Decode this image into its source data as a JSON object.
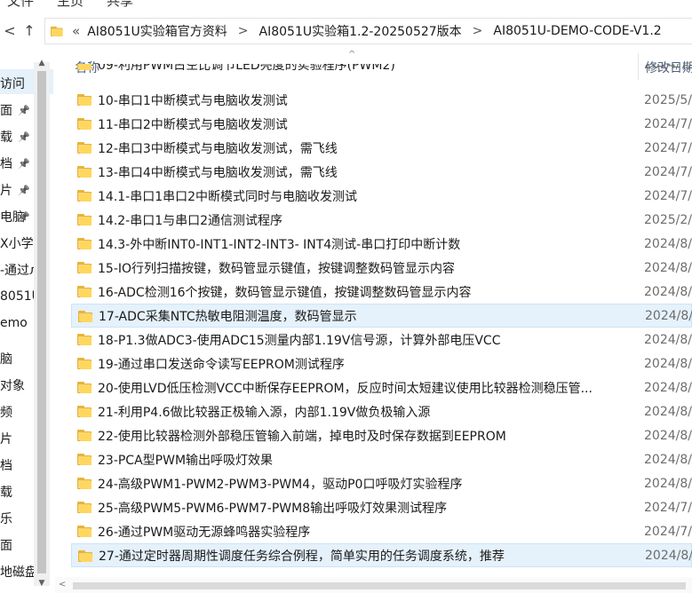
{
  "menu": {
    "items": [
      "文件",
      "主页",
      "共享",
      "查看"
    ]
  },
  "nav": {
    "back_glyph": "<",
    "up_glyph": "↑",
    "address_lead": "«",
    "breadcrumbs": [
      "AI8051U实验箱官方资料",
      "AI8051U实验箱1.2-20250527版本",
      "AI8051U-DEMO-CODE-V1.2"
    ],
    "crumb_sep": ">"
  },
  "navpane": {
    "items": [
      {
        "label": "访问",
        "pinned": false
      },
      {
        "label": "面",
        "pinned": true
      },
      {
        "label": "载",
        "pinned": true
      },
      {
        "label": "档",
        "pinned": true
      },
      {
        "label": "片",
        "pinned": true
      },
      {
        "label": "电脑",
        "pinned": true
      },
      {
        "label": "X小学",
        "pinned": false
      },
      {
        "label": "-通过л",
        "pinned": false
      },
      {
        "label": "8051U",
        "pinned": false
      },
      {
        "label": "emo",
        "pinned": false
      },
      {
        "label": "脑",
        "pinned": false
      },
      {
        "label": "对象",
        "pinned": false
      },
      {
        "label": "频",
        "pinned": false
      },
      {
        "label": "片",
        "pinned": false
      },
      {
        "label": "档",
        "pinned": false
      },
      {
        "label": "载",
        "pinned": false
      },
      {
        "label": "乐",
        "pinned": false
      },
      {
        "label": "面",
        "pinned": false
      },
      {
        "label": "地磁盘",
        "pinned": false
      }
    ]
  },
  "list": {
    "header": {
      "name": "名称",
      "date": "修改日期"
    },
    "rows": [
      {
        "name": "09-利用PWM占空比调节LED亮度的实验程序(PWM2)",
        "date": "2024/7/",
        "selected": false,
        "partial": true
      },
      {
        "name": "10-串口1中断模式与电脑收发测试",
        "date": "2025/5/",
        "selected": false
      },
      {
        "name": "11-串口2中断模式与电脑收发测试",
        "date": "2024/7/",
        "selected": false
      },
      {
        "name": "12-串口3中断模式与电脑收发测试，需飞线",
        "date": "2024/7/",
        "selected": false
      },
      {
        "name": "13-串口4中断模式与电脑收发测试，需飞线",
        "date": "2024/7/",
        "selected": false
      },
      {
        "name": "14.1-串口1串口2中断模式同时与电脑收发测试",
        "date": "2024/7/",
        "selected": false
      },
      {
        "name": "14.2-串口1与串口2通信测试程序",
        "date": "2025/2/",
        "selected": false
      },
      {
        "name": "14.3-外中断INT0-INT1-INT2-INT3- INT4测试-串口打印中断计数",
        "date": "2024/8/",
        "selected": false
      },
      {
        "name": "15-IO行列扫描按键，数码管显示键值，按键调整数码管显示内容",
        "date": "2024/8/",
        "selected": false
      },
      {
        "name": "16-ADC检测16个按键，数码管显示键值，按键调整数码管显示内容",
        "date": "2024/8/",
        "selected": false
      },
      {
        "name": "17-ADC采集NTC热敏电阻测温度，数码管显示",
        "date": "2024/8/",
        "selected": true
      },
      {
        "name": "18-P1.3做ADC3-使用ADC15测量内部1.19V信号源，计算外部电压VCC",
        "date": "2024/8/",
        "selected": false
      },
      {
        "name": "19-通过串口发送命令读写EEPROM测试程序",
        "date": "2024/8/",
        "selected": false
      },
      {
        "name": "20-使用LVD低压检测VCC中断保存EEPROM，反应时间太短建议使用比较器检测稳压管...",
        "date": "2024/8/",
        "selected": false
      },
      {
        "name": "21-利用P4.6做比较器正极输入源，内部1.19V做负极输入源",
        "date": "2024/8/",
        "selected": false
      },
      {
        "name": "22-使用比较器检测外部稳压管输入前端，掉电时及时保存数据到EEPROM",
        "date": "2024/8/",
        "selected": false
      },
      {
        "name": "23-PCA型PWM输出呼吸灯效果",
        "date": "2024/8/",
        "selected": false
      },
      {
        "name": "24-高级PWM1-PWM2-PWM3-PWM4，驱动P0口呼吸灯实验程序",
        "date": "2024/8/",
        "selected": false
      },
      {
        "name": "25-高级PWM5-PWM6-PWM7-PWM8输出呼吸灯效果测试程序",
        "date": "2024/7/",
        "selected": false
      },
      {
        "name": "26-通过PWM驱动无源蜂鸣器实验程序",
        "date": "2024/7/",
        "selected": false
      },
      {
        "name": "27-通过定时器周期性调度任务综合例程，简单实用的任务调度系统，推荐",
        "date": "2024/8/",
        "selected": true
      }
    ]
  }
}
